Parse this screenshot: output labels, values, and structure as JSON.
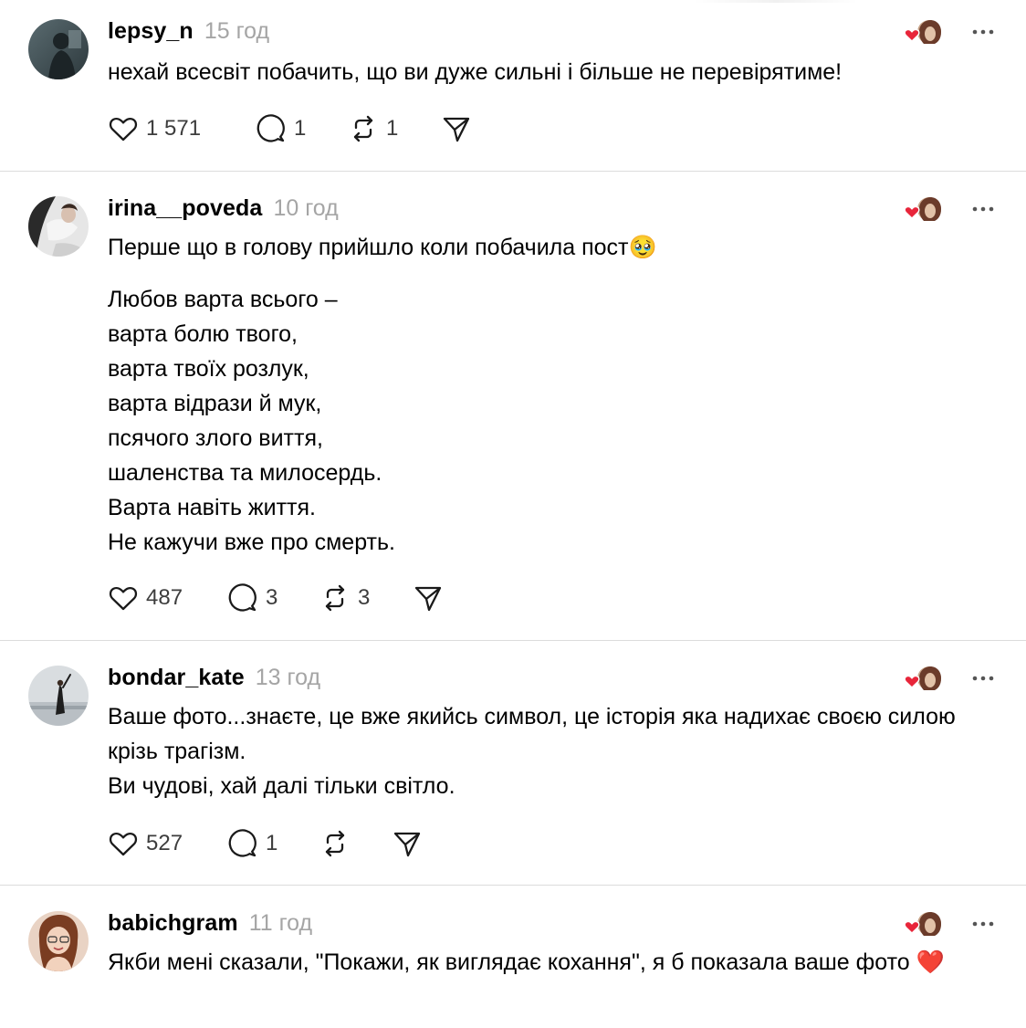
{
  "colors": {
    "text": "#000000",
    "muted": "#a5a5a5",
    "count": "#3d3d3d",
    "divider": "#dcdcdc",
    "heart": "#e8253a"
  },
  "posts": [
    {
      "username": "lepsy_n",
      "time": "15 год",
      "paragraphs": [
        "нехай всесвіт побачить, що ви дуже сильні і більше не перевірятиме!"
      ],
      "likes": "1 571",
      "replies": "1",
      "reposts": "1"
    },
    {
      "username": "irina__poveda",
      "time": "10 год",
      "paragraphs": [
        "Перше що в голову прийшло коли побачила пост🥹",
        "Любов варта всього –\nварта болю твого,\nварта твоїх розлук,\nварта відрази й мук,\nпсячого злого виття,\nшаленства та милосердь.\nВарта навіть життя.\nНе кажучи вже про смерть."
      ],
      "likes": "487",
      "replies": "3",
      "reposts": "3"
    },
    {
      "username": "bondar_kate",
      "time": "13 год",
      "paragraphs": [
        "Ваше фото...знаєте, це вже якийсь символ, це історія яка надихає своєю силою крізь трагізм.\nВи чудові, хай далі тільки світло."
      ],
      "likes": "527",
      "replies": "1",
      "reposts": ""
    },
    {
      "username": "babichgram",
      "time": "11 год",
      "paragraphs": [
        "Якби мені сказали, \"Покажи, як виглядає кохання\", я б показала ваше фото ❤️"
      ]
    }
  ]
}
